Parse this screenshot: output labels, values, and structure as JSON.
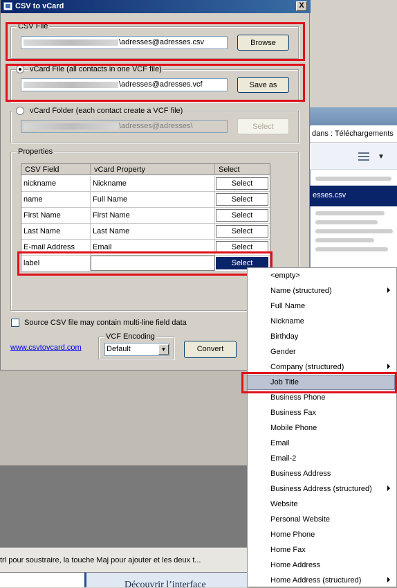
{
  "dialog": {
    "title": "CSV to vCard",
    "close_label": "X",
    "csv_file": {
      "group_label": "CSV File",
      "path": "\\adresses@adresses.csv",
      "browse_label": "Browse"
    },
    "vcard_file": {
      "radio_label": "vCard File (all contacts in one VCF file)",
      "path": "\\adresses@adresses.vcf",
      "save_label": "Save as",
      "checked": true
    },
    "vcard_folder": {
      "radio_label": "vCard Folder (each contact create a VCF file)",
      "path": "\\adresses@adresses\\",
      "select_label": "Select",
      "checked": false
    },
    "properties": {
      "group_label": "Properties",
      "columns": [
        "CSV Field",
        "vCard Property",
        "Select"
      ],
      "rows": [
        {
          "csv": "nickname",
          "vcard": "Nickname",
          "btn": "Select"
        },
        {
          "csv": "name",
          "vcard": "Full Name",
          "btn": "Select"
        },
        {
          "csv": "First Name",
          "vcard": "First Name",
          "btn": "Select"
        },
        {
          "csv": "Last Name",
          "vcard": "Last Name",
          "btn": "Select"
        },
        {
          "csv": "E-mail Address",
          "vcard": "Email",
          "btn": "Select"
        },
        {
          "csv": "label",
          "vcard": "",
          "btn": "Select"
        }
      ]
    },
    "multiline_label": "Source CSV file may contain multi-line field data",
    "link_text": "www.csvtovcard.com",
    "encoding": {
      "group_label": "VCF Encoding",
      "value": "Default"
    },
    "convert_label": "Convert"
  },
  "menu": {
    "items": [
      {
        "label": "<empty>",
        "submenu": false
      },
      {
        "label": "Name (structured)",
        "submenu": true
      },
      {
        "label": "Full Name",
        "submenu": false
      },
      {
        "label": "Nickname",
        "submenu": false
      },
      {
        "label": "Birthday",
        "submenu": false
      },
      {
        "label": "Gender",
        "submenu": false
      },
      {
        "label": "Company (structured)",
        "submenu": true
      },
      {
        "label": "Job Title",
        "submenu": false
      },
      {
        "label": "Business Phone",
        "submenu": false
      },
      {
        "label": "Business Fax",
        "submenu": false
      },
      {
        "label": "Mobile Phone",
        "submenu": false
      },
      {
        "label": "Email",
        "submenu": false
      },
      {
        "label": "Email-2",
        "submenu": false
      },
      {
        "label": "Business Address",
        "submenu": false
      },
      {
        "label": "Business Address (structured)",
        "submenu": true
      },
      {
        "label": "Website",
        "submenu": false
      },
      {
        "label": "Personal Website",
        "submenu": false
      },
      {
        "label": "Home Phone",
        "submenu": false
      },
      {
        "label": "Home Fax",
        "submenu": false
      },
      {
        "label": "Home Address",
        "submenu": false
      },
      {
        "label": "Home Address (structured)",
        "submenu": true
      }
    ],
    "highlighted": "Job Title"
  },
  "background": {
    "explorer_location": "dans : Téléchargements",
    "explorer_selected_file": "esses.csv",
    "status_text": "trl pour soustraire, la touche Maj pour ajouter et les deux t...",
    "banner_text": "Découvrir l’interface"
  },
  "colors": {
    "highlight_box": "#e0101a",
    "titlebar": "#0a246a",
    "menu_highlight": "#bcc3d3"
  }
}
